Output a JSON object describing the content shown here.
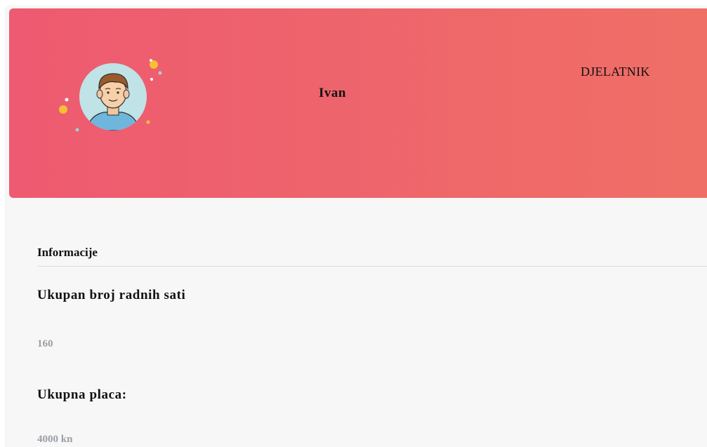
{
  "profile": {
    "name": "Ivan",
    "role": "DJELATNIK"
  },
  "info": {
    "section_title": "Informacije",
    "hours_label": "Ukupan broj radnih sati",
    "hours_value": "160",
    "salary_label": "Ukupna placa:",
    "salary_value": "4000 kn"
  },
  "colors": {
    "header_gradient_start": "#ee5a71",
    "header_gradient_end": "#ef6f66",
    "value_gray": "#9a9fa6",
    "card_background": "#f7f7f7",
    "avatar_circle": "#bfe3e6"
  },
  "icons": {
    "avatar": "user-avatar-illustration"
  }
}
